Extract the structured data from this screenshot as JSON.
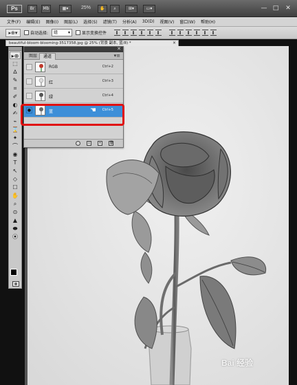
{
  "app": {
    "logo": "Ps",
    "buttons": [
      "Br",
      "Mb"
    ],
    "zoom": "25%",
    "window_controls": [
      "—",
      "□",
      "✕"
    ]
  },
  "menu": [
    "文件(F)",
    "编辑(E)",
    "图像(I)",
    "图层(L)",
    "选择(S)",
    "滤镜(T)",
    "分析(A)",
    "3D(D)",
    "视图(V)",
    "窗口(W)",
    "帮助(H)"
  ],
  "options": {
    "auto_select_label": "自动选择:",
    "auto_select_value": "组",
    "show_transform_label": "显示变换控件"
  },
  "document": {
    "tab_title": "beautiful-bloom-blooming-3517358.jpg @ 25% (背景 副本, 蓝/8) *",
    "close": "×"
  },
  "tools": [
    "▸⊕",
    "⬚",
    "ᐃ",
    "✎",
    "⌗",
    "✐",
    "◐",
    "✍",
    "⌁",
    "⌛",
    "✦",
    "⌒",
    "◉",
    "T",
    "↖",
    "◇",
    "☐",
    "✋",
    "⌕",
    "⊙",
    "▲",
    "⬬",
    "⦿"
  ],
  "panel": {
    "tabs": [
      "图层",
      "通道"
    ],
    "active_tab": "通道",
    "channels": [
      {
        "name": "RGB",
        "shortcut": "Ctrl+2"
      },
      {
        "name": "红",
        "shortcut": "Ctrl+3"
      },
      {
        "name": "绿",
        "shortcut": "Ctrl+4"
      },
      {
        "name": "蓝",
        "shortcut": "Ctrl+5"
      }
    ],
    "selected_channel": "蓝",
    "footer_buttons": [
      "load-selection",
      "save-selection",
      "new-channel",
      "delete-channel"
    ]
  },
  "watermark": "Bai 经验"
}
